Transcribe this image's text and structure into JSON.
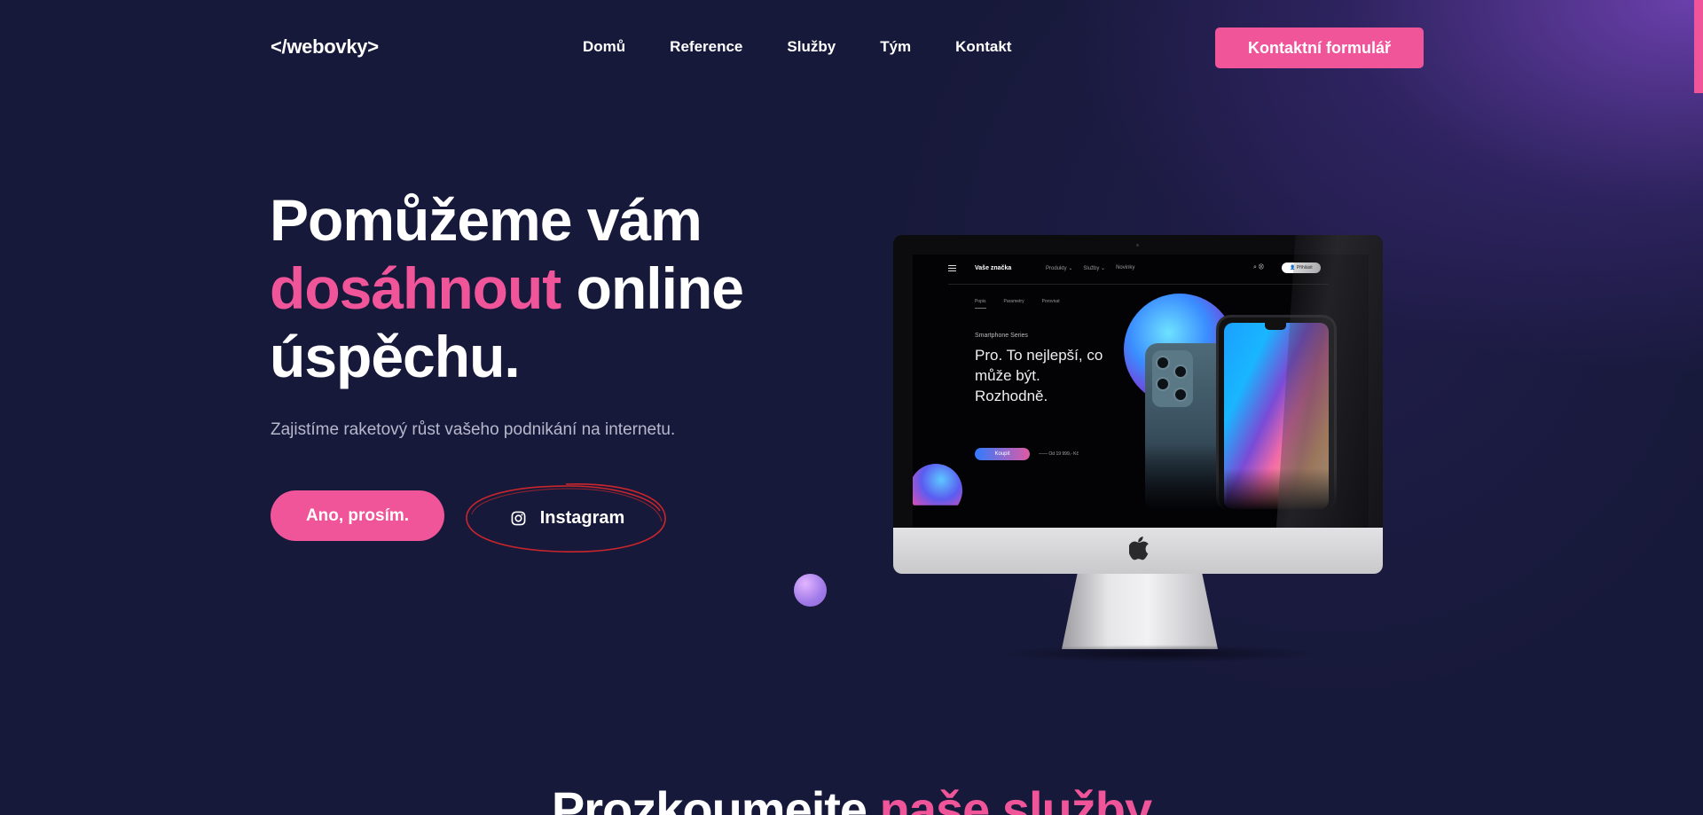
{
  "header": {
    "logo": "</webovky>",
    "nav": [
      {
        "label": "Domů"
      },
      {
        "label": "Reference"
      },
      {
        "label": "Služby"
      },
      {
        "label": "Tým"
      },
      {
        "label": "Kontakt"
      }
    ],
    "cta_label": "Kontaktní formulář"
  },
  "hero": {
    "title_line1": "Pomůžeme vám",
    "title_highlight": "dosáhnout",
    "title_line2_rest": " online",
    "title_line3": "úspěchu.",
    "subtitle": "Zajistíme raketový růst vašeho podnikání na internetu.",
    "primary_button": "Ano, prosím.",
    "instagram_button": "Instagram"
  },
  "mockup": {
    "brand": "Vaše značka",
    "links": [
      "Produkty ⌄",
      "Služby ⌄",
      "Novinky"
    ],
    "icons": "⌕  ⛒",
    "login": "👤 Přihlásit",
    "tabs": [
      "Popis",
      "Parametry",
      "Porovnat"
    ],
    "series": "Smartphone Series",
    "headline": "Pro. To nejlepší, co může být. Rozhodně.",
    "buy": "Koupit",
    "price": "——  Od 19 999,- Kč"
  },
  "next_section": {
    "title_start": "Prozkoumejte ",
    "title_highlight": "naše služby"
  },
  "colors": {
    "background": "#17193a",
    "accent": "#f0559a",
    "glow": "#6a3fb0",
    "annotation": "#c8262c"
  }
}
